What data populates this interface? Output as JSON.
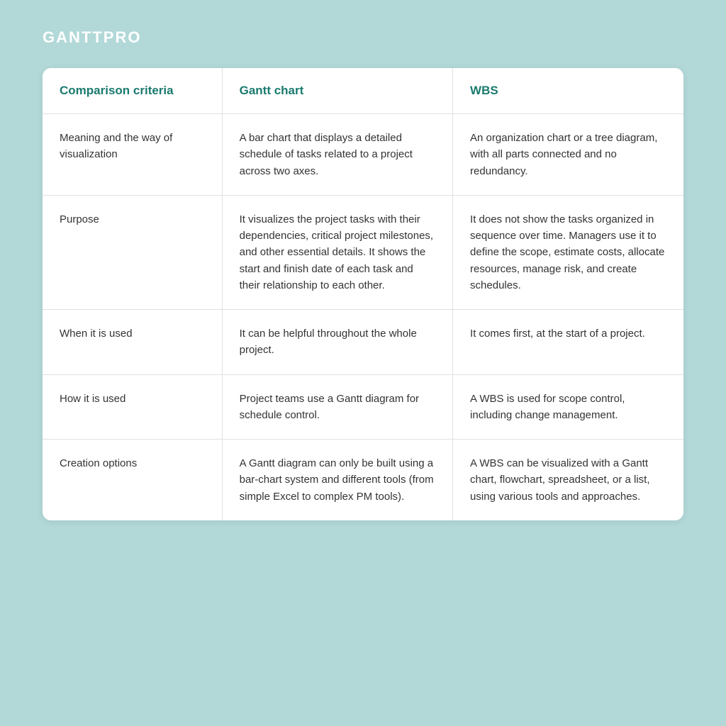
{
  "logo": {
    "text": "GANTTPRO"
  },
  "table": {
    "headers": {
      "criteria": "Comparison criteria",
      "gantt": "Gantt chart",
      "wbs": "WBS"
    },
    "rows": [
      {
        "criteria": "Meaning and the way of visualization",
        "gantt": "A bar chart that displays a detailed schedule of tasks related to a project across two axes.",
        "wbs": "An organization chart or a tree diagram, with all parts connected and no redundancy."
      },
      {
        "criteria": "Purpose",
        "gantt": "It visualizes the project tasks with their dependencies, critical project milestones, and other essential details. It shows the start and finish date of each task and their relationship to each other.",
        "wbs": "It does not show the tasks organized in sequence over time. Managers use it to define the scope, estimate costs, allocate resources, manage risk, and create schedules."
      },
      {
        "criteria": "When it is used",
        "gantt": "It can be helpful throughout the whole project.",
        "wbs": "It comes first, at the start of a project."
      },
      {
        "criteria": "How it is used",
        "gantt": "Project teams use a Gantt diagram for schedule control.",
        "wbs": "A WBS is used for scope control, including change management."
      },
      {
        "criteria": "Creation options",
        "gantt": "A Gantt diagram can only be built using a bar-chart system and different tools (from simple Excel to complex PM tools).",
        "wbs": "A WBS can be visualized with a Gantt chart, flowchart, spreadsheet, or a list, using various tools and approaches."
      }
    ]
  }
}
